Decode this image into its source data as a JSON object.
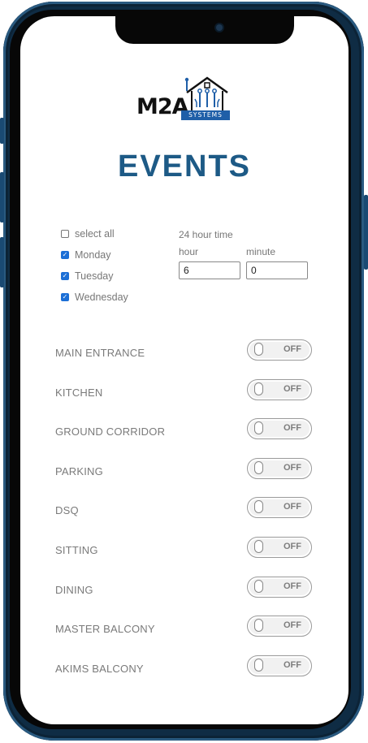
{
  "app": {
    "logo_text": "M2A",
    "logo_subtext": "SYSTEMS",
    "brand_color": "#1d5a86",
    "logo_band_color": "#1f5fa8"
  },
  "page": {
    "title": "EVENTS"
  },
  "schedule": {
    "days": [
      {
        "label": "select all",
        "checked": false
      },
      {
        "label": "Monday",
        "checked": true
      },
      {
        "label": "Tuesday",
        "checked": true
      },
      {
        "label": "Wednesday",
        "checked": true
      }
    ],
    "time_heading": "24 hour time",
    "hour_label": "hour",
    "minute_label": "minute",
    "hour_value": "6",
    "minute_value": "0"
  },
  "devices": [
    {
      "name": "MAIN ENTRANCE",
      "state": "OFF"
    },
    {
      "name": "KITCHEN",
      "state": "OFF"
    },
    {
      "name": "GROUND CORRIDOR",
      "state": "OFF"
    },
    {
      "name": "PARKING",
      "state": "OFF"
    },
    {
      "name": "DSQ",
      "state": "OFF"
    },
    {
      "name": "SITTING",
      "state": "OFF"
    },
    {
      "name": "DINING",
      "state": "OFF"
    },
    {
      "name": "MASTER BALCONY",
      "state": "OFF"
    },
    {
      "name": "AKIMS BALCONY",
      "state": "OFF"
    }
  ]
}
